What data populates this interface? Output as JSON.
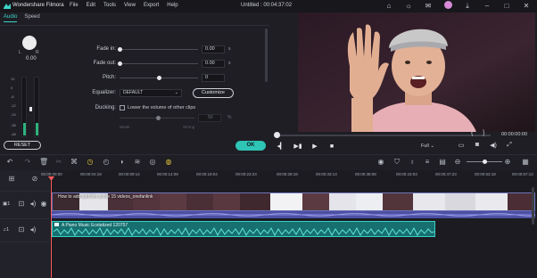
{
  "titlebar": {
    "app_name": "Wondershare Filmora",
    "menu": [
      "File",
      "Edit",
      "Tools",
      "View",
      "Export",
      "Help"
    ],
    "project_title": "Untitled : 00:04:37:02"
  },
  "panel": {
    "tabs": [
      "Audio",
      "Speed"
    ],
    "active_tab": "Audio",
    "balance": {
      "left": "L",
      "right": "R",
      "value": "0.00"
    },
    "meter_scale": [
      "12",
      "0",
      "-6",
      "-12",
      "-24",
      "-36",
      "-48"
    ],
    "fade_in": {
      "label": "Fade in:",
      "value": "0.00",
      "unit": "s"
    },
    "fade_out": {
      "label": "Fade out:",
      "value": "0.00",
      "unit": "s"
    },
    "pitch": {
      "label": "Pitch:",
      "value": "0"
    },
    "equalizer": {
      "label": "Equalizer:",
      "value": "DEFAULT",
      "customize_label": "Customize"
    },
    "ducking": {
      "label": "Ducking:",
      "checkbox_label": "Lower the volume of other clips",
      "value": "50",
      "unit": "%",
      "weak": "Weak",
      "strong": "Strong"
    },
    "reset_label": "RESET",
    "ok_label": "OK"
  },
  "preview": {
    "time": "00:00:00:00",
    "in_bracket": "{",
    "out_bracket": "}",
    "quality": "Full"
  },
  "timeline": {
    "ruler": [
      "00:00:00:00",
      "00:00:04:19",
      "00:00:09:14",
      "00:00:14:09",
      "00:00:19:04",
      "00:00:23:23",
      "00:00:28:18",
      "00:00:33:13",
      "00:00:38:08",
      "00:00:43:03",
      "00:00:47:23",
      "00:00:52:18",
      "00:00:57:13"
    ],
    "video_clip_label": "How to add and film at the 15 videos_onefanlink",
    "music_clip_label": "A Piano Music Ecstatized 120757",
    "video_track_number": "1",
    "audio_track_number": "1"
  },
  "colors": {
    "accent": "#2ec4b6",
    "playhead": "#ff5b5b",
    "video_clip": "#6d74b8",
    "music_clip": "#176f6f"
  }
}
